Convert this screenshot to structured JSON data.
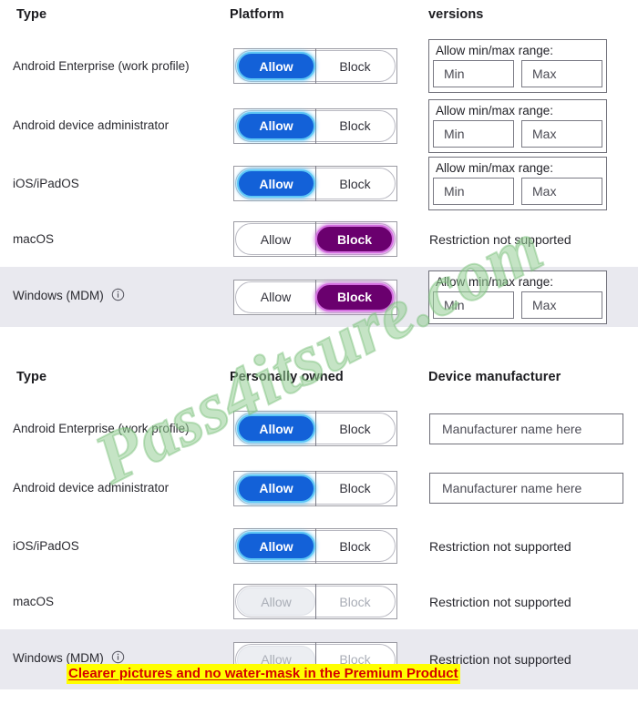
{
  "watermark": {
    "text": "Pass4itsure.com"
  },
  "promo_banner": {
    "text": "Clearer pictures and no water-mask in the Premium Product"
  },
  "tables": [
    {
      "id": "platform-versions",
      "headers": {
        "type": "Type",
        "middle": "Platform",
        "right": "versions"
      },
      "rows": [
        {
          "type": "Android Enterprise (work profile)",
          "toggle": {
            "left_label": "Allow",
            "right_label": "Block",
            "selected": "Allow",
            "style": "blue"
          },
          "right": {
            "kind": "range",
            "title": "Allow min/max range:",
            "min_label": "Min",
            "max_label": "Max"
          },
          "shaded": false
        },
        {
          "type": "Android device administrator",
          "toggle": {
            "left_label": "Allow",
            "right_label": "Block",
            "selected": "Allow",
            "style": "blue"
          },
          "right": {
            "kind": "range",
            "title": "Allow min/max range:",
            "min_label": "Min",
            "max_label": "Max"
          },
          "shaded": false
        },
        {
          "type": "iOS/iPadOS",
          "toggle": {
            "left_label": "Allow",
            "right_label": "Block",
            "selected": "Allow",
            "style": "blue"
          },
          "right": {
            "kind": "range",
            "title": "Allow min/max range:",
            "min_label": "Min",
            "max_label": "Max"
          },
          "shaded": false
        },
        {
          "type": "macOS",
          "toggle": {
            "left_label": "Allow",
            "right_label": "Block",
            "selected": "Block",
            "style": "purple"
          },
          "right": {
            "kind": "text",
            "text": "Restriction not supported"
          },
          "shaded": false
        },
        {
          "type": "Windows (MDM)",
          "has_info_icon": true,
          "info_icon_name": "info-icon",
          "toggle": {
            "left_label": "Allow",
            "right_label": "Block",
            "selected": "Block",
            "style": "purple"
          },
          "right": {
            "kind": "range",
            "title": "Allow min/max range:",
            "min_label": "Min",
            "max_label": "Max"
          },
          "shaded": true
        }
      ]
    },
    {
      "id": "personally-owned-manufacturer",
      "headers": {
        "type": "Type",
        "middle": "Personally owned",
        "right": "Device manufacturer"
      },
      "rows": [
        {
          "type": "Android Enterprise (work profile)",
          "toggle": {
            "left_label": "Allow",
            "right_label": "Block",
            "selected": "Allow",
            "style": "blue"
          },
          "right": {
            "kind": "input",
            "placeholder": "Manufacturer name here"
          },
          "shaded": false
        },
        {
          "type": "Android device administrator",
          "toggle": {
            "left_label": "Allow",
            "right_label": "Block",
            "selected": "Allow",
            "style": "blue"
          },
          "right": {
            "kind": "input",
            "placeholder": "Manufacturer name here"
          },
          "shaded": false
        },
        {
          "type": "iOS/iPadOS",
          "toggle": {
            "left_label": "Allow",
            "right_label": "Block",
            "selected": "Allow",
            "style": "blue"
          },
          "right": {
            "kind": "text",
            "text": "Restriction not supported"
          },
          "shaded": false
        },
        {
          "type": "macOS",
          "toggle": {
            "left_label": "Allow",
            "right_label": "Block",
            "selected": "Allow",
            "style": "muted"
          },
          "right": {
            "kind": "text",
            "text": "Restriction not supported"
          },
          "shaded": false
        },
        {
          "type": "Windows (MDM)",
          "has_info_icon": true,
          "info_icon_name": "info-icon",
          "toggle": {
            "left_label": "Allow",
            "right_label": "Block",
            "selected": "Allow",
            "style": "muted"
          },
          "right": {
            "kind": "text",
            "text": "Restriction not supported"
          },
          "shaded": true
        }
      ]
    }
  ],
  "colors": {
    "allow_pill": "#1361d8",
    "allow_glow": "#5ec6f5",
    "block_pill": "#6a006e",
    "block_glow": "#d46fe0",
    "shaded_row": "#e9e9ef",
    "promo_bg": "#ffff00",
    "promo_fg": "#d60000",
    "watermark": "#96cd96"
  }
}
